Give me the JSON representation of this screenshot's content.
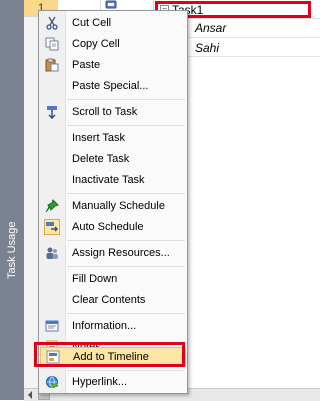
{
  "view_bar": {
    "label": "Task Usage"
  },
  "row_header": {
    "active_row": "1"
  },
  "grid": {
    "task_name": "Task1",
    "collapse_glyph": "−",
    "assignments": [
      "Ansar",
      "Sahi"
    ]
  },
  "context_menu": {
    "items": [
      {
        "label": "Cut Cell",
        "icon": "scissors-icon"
      },
      {
        "label": "Copy Cell",
        "icon": "copy-icon"
      },
      {
        "label": "Paste",
        "icon": "paste-icon"
      },
      {
        "label": "Paste Special...",
        "icon": ""
      },
      {
        "label": "Scroll to Task",
        "icon": "scroll-to-task-icon"
      },
      {
        "label": "Insert Task",
        "icon": ""
      },
      {
        "label": "Delete Task",
        "icon": ""
      },
      {
        "label": "Inactivate Task",
        "icon": ""
      },
      {
        "label": "Manually Schedule",
        "icon": "pushpin-icon"
      },
      {
        "label": "Auto Schedule",
        "icon": "auto-schedule-icon"
      },
      {
        "label": "Assign Resources...",
        "icon": "assign-resources-icon"
      },
      {
        "label": "Fill Down",
        "icon": ""
      },
      {
        "label": "Clear Contents",
        "icon": ""
      },
      {
        "label": "Information...",
        "icon": "information-icon"
      },
      {
        "label": "Notes...",
        "icon": "notes-icon"
      },
      {
        "label": "Add to Timeline",
        "icon": "add-to-timeline-icon"
      },
      {
        "label": "Hyperlink...",
        "icon": "hyperlink-icon"
      }
    ],
    "highlighted_item": "Add to Timeline"
  },
  "colors": {
    "highlight_red": "#e0001b",
    "menu_hover": "#fbe7a1",
    "active_row_header": "#f9d889",
    "view_bar": "#7a8291"
  }
}
